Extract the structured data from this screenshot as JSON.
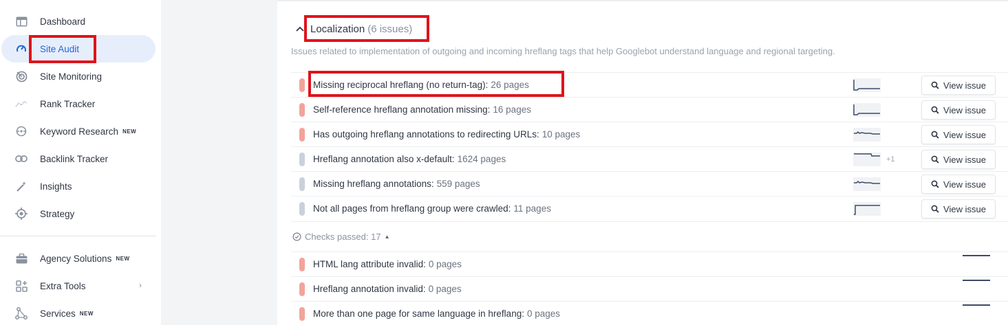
{
  "sidebar": {
    "items": [
      {
        "label": "Dashboard",
        "icon": "dashboard-icon",
        "new": false
      },
      {
        "label": "Site Audit",
        "icon": "speedometer-icon",
        "new": false,
        "active": true
      },
      {
        "label": "Site Monitoring",
        "icon": "radar-icon",
        "new": false
      },
      {
        "label": "Rank Tracker",
        "icon": "trend-icon",
        "new": false
      },
      {
        "label": "Keyword Research",
        "icon": "keyword-icon",
        "new": true
      },
      {
        "label": "Backlink Tracker",
        "icon": "link-icon",
        "new": false
      },
      {
        "label": "Insights",
        "icon": "magic-wand-icon",
        "new": false
      },
      {
        "label": "Strategy",
        "icon": "target-icon",
        "new": false
      }
    ],
    "items2": [
      {
        "label": "Agency Solutions",
        "icon": "briefcase-icon",
        "new": true
      },
      {
        "label": "Extra Tools",
        "icon": "grid-plus-icon",
        "new": false,
        "chevron": true
      },
      {
        "label": "Services",
        "icon": "nodes-icon",
        "new": true
      }
    ],
    "new_badge": "NEW"
  },
  "section": {
    "title": "Localization",
    "count": "(6 issues)",
    "description": "Issues related to implementation of outgoing and incoming hreflang tags that help Googlebot understand language and regional targeting."
  },
  "issues": [
    {
      "label": "Missing reciprocal hreflang (no return-tag):",
      "pages": "26 pages",
      "severity": "error",
      "trend": "drop",
      "delta": ""
    },
    {
      "label": "Self-reference hreflang annotation missing:",
      "pages": "16 pages",
      "severity": "error",
      "trend": "drop",
      "delta": ""
    },
    {
      "label": "Has outgoing hreflang annotations to redirecting URLs:",
      "pages": "10 pages",
      "severity": "error",
      "trend": "flat-wave",
      "delta": ""
    },
    {
      "label": "Hreflang annotation also x-default:",
      "pages": "1624 pages",
      "severity": "notice",
      "trend": "step-down",
      "delta": "+1"
    },
    {
      "label": "Missing hreflang annotations:",
      "pages": "559 pages",
      "severity": "notice",
      "trend": "flat-wave",
      "delta": ""
    },
    {
      "label": "Not all pages from hreflang group were crawled:",
      "pages": "11 pages",
      "severity": "notice",
      "trend": "rise",
      "delta": ""
    }
  ],
  "view_issue_label": "View issue",
  "checks_passed": "Checks passed: 17",
  "passed": [
    {
      "label": "HTML lang attribute invalid:",
      "pages": "0 pages"
    },
    {
      "label": "Hreflang annotation invalid:",
      "pages": "0 pages"
    },
    {
      "label": "More than one page for same language in hreflang:",
      "pages": "0 pages"
    }
  ],
  "colors": {
    "accent": "#1f66d8",
    "error": "#f3a39a",
    "notice": "#c9d1da",
    "highlight": "#e0131b"
  }
}
